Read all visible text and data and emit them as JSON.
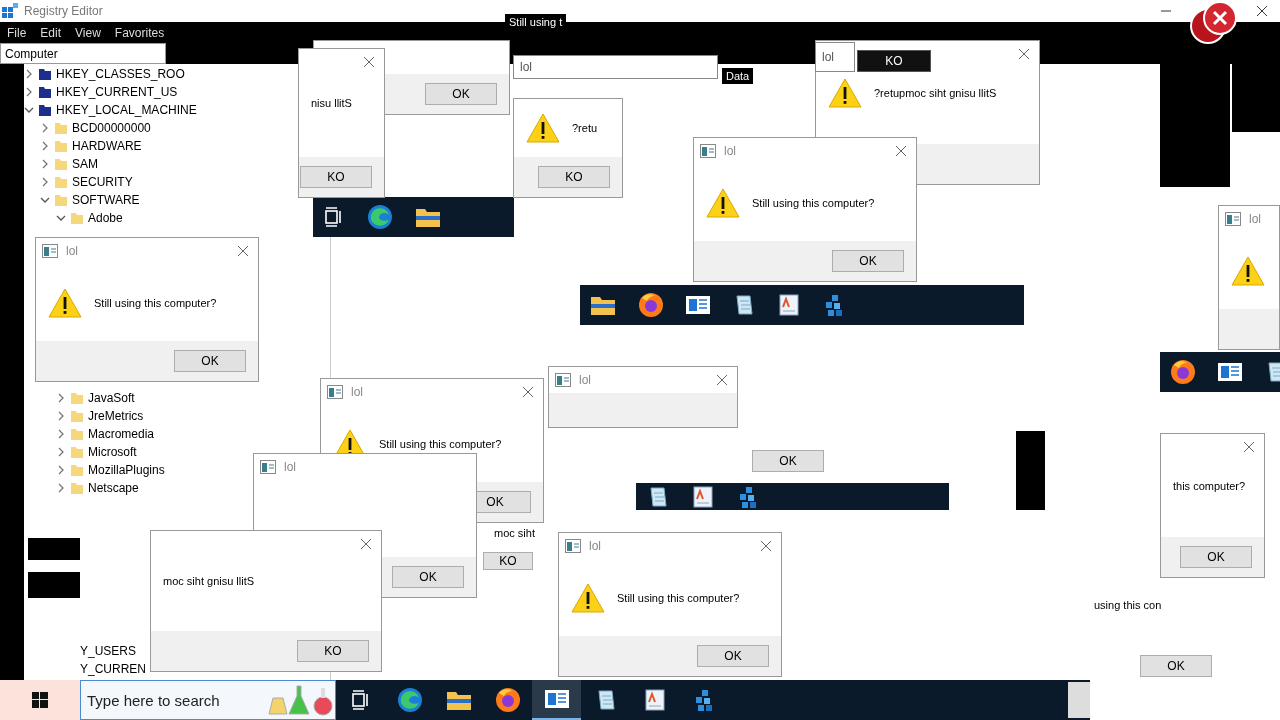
{
  "registry_editor": {
    "title": "Registry Editor",
    "menu": [
      "File",
      "Edit",
      "View",
      "Favorites"
    ],
    "address": "Computer",
    "tree": [
      {
        "label": "HKEY_CLASSES_ROO",
        "expanded": false
      },
      {
        "label": "HKEY_CURRENT_US",
        "expanded": false
      },
      {
        "label": "HKEY_LOCAL_MACHINE",
        "expanded": true,
        "children": [
          {
            "label": "BCD00000000",
            "expanded": false
          },
          {
            "label": "HARDWARE",
            "expanded": false
          },
          {
            "label": "SAM",
            "expanded": false
          },
          {
            "label": "SECURITY",
            "expanded": false
          },
          {
            "label": "SOFTWARE",
            "expanded": true,
            "children": [
              {
                "label": "Adobe",
                "expanded": true
              },
              {
                "label": "JavaSoft",
                "expanded": false
              },
              {
                "label": "JreMetrics",
                "expanded": false
              },
              {
                "label": "Macromedia",
                "expanded": false
              },
              {
                "label": "Microsoft",
                "expanded": false
              },
              {
                "label": "MozillaPlugins",
                "expanded": false
              },
              {
                "label": "Netscape",
                "expanded": false
              }
            ]
          }
        ]
      }
    ],
    "tree_tail": [
      "Y_USERS",
      "Y_CURREN"
    ]
  },
  "windows": [
    {
      "kind": "dialog",
      "button": "OK",
      "icon": false,
      "close": false
    },
    {
      "kind": "dialog",
      "message": "nisu llitS",
      "button": "KO",
      "icon": false,
      "close": true
    },
    {
      "kind": "dialog",
      "message": "?retu",
      "button": "KO",
      "icon": true,
      "close": false
    },
    {
      "kind": "title",
      "text": "lol"
    },
    {
      "kind": "dialog",
      "message": "?retupmoc siht gnisu llitS",
      "icon": true,
      "close": true
    },
    {
      "kind": "title",
      "text": "lol"
    },
    {
      "kind": "button",
      "text": "KO",
      "dark": true
    },
    {
      "kind": "text",
      "text": "Still using t",
      "dark": true
    },
    {
      "kind": "text",
      "text": "Data",
      "dark": true
    },
    {
      "kind": "dialog",
      "title": "lol",
      "message": "Still using this computer?",
      "button": "OK",
      "icon": true,
      "close": true
    },
    {
      "kind": "dialog",
      "title": "lol",
      "message": "Still using this computer?",
      "button": "OK",
      "icon": true,
      "close": true
    },
    {
      "kind": "dialog",
      "title": "lol",
      "message": "Still using this computer?",
      "button": "OK",
      "icon": true,
      "close": true
    },
    {
      "kind": "dialog",
      "title": "lol",
      "icon": false,
      "close": true
    },
    {
      "kind": "button",
      "text": "OK",
      "dark": false
    },
    {
      "kind": "dialog",
      "title": "lol",
      "button": "OK",
      "icon": false,
      "close": false
    },
    {
      "kind": "dialog",
      "message": "moc siht gnisu llitS",
      "button": "KO",
      "icon": false,
      "close": true
    },
    {
      "kind": "text",
      "text": "moc siht",
      "dark": false
    },
    {
      "kind": "button",
      "text": "KO",
      "dark": false
    },
    {
      "kind": "dialog",
      "title": "lol",
      "message": "Still using this computer?",
      "button": "OK",
      "icon": true,
      "close": true
    },
    {
      "kind": "dialog",
      "message": "this computer?",
      "button": "OK",
      "icon": false,
      "close": true
    },
    {
      "kind": "dialog",
      "title": "lol",
      "icon": true,
      "close": false
    },
    {
      "kind": "text",
      "text": "using this con",
      "dark": false
    },
    {
      "kind": "button",
      "text": "OK",
      "dark": false
    }
  ],
  "taskbar": {
    "search": {
      "placeholder": "Type here to search"
    },
    "apps": [
      {
        "kind": "taskview",
        "active": false
      },
      {
        "kind": "edge",
        "active": false
      },
      {
        "kind": "folder",
        "active": false
      },
      {
        "kind": "firefox",
        "active": false
      },
      {
        "kind": "app",
        "active": true
      },
      {
        "kind": "notepad",
        "active": false
      },
      {
        "kind": "wordpad",
        "active": false
      },
      {
        "kind": "cubes",
        "active": false
      }
    ]
  }
}
